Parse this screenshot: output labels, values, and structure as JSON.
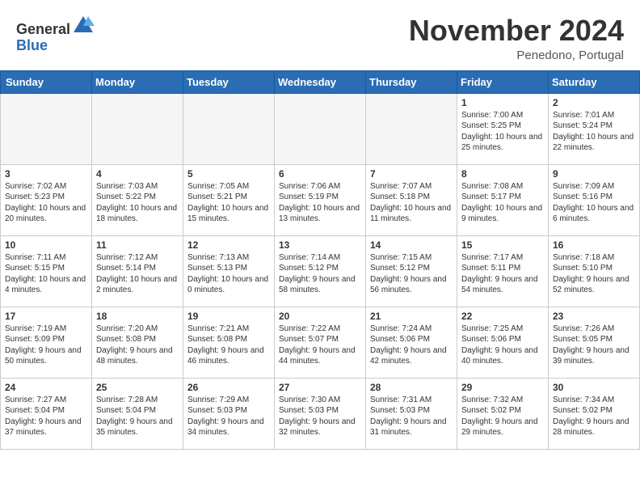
{
  "header": {
    "logo_general": "General",
    "logo_blue": "Blue",
    "month_title": "November 2024",
    "location": "Penedono, Portugal"
  },
  "days_of_week": [
    "Sunday",
    "Monday",
    "Tuesday",
    "Wednesday",
    "Thursday",
    "Friday",
    "Saturday"
  ],
  "weeks": [
    [
      {
        "day": "",
        "empty": true
      },
      {
        "day": "",
        "empty": true
      },
      {
        "day": "",
        "empty": true
      },
      {
        "day": "",
        "empty": true
      },
      {
        "day": "",
        "empty": true
      },
      {
        "day": "1",
        "sunrise": "Sunrise: 7:00 AM",
        "sunset": "Sunset: 5:25 PM",
        "daylight": "Daylight: 10 hours and 25 minutes."
      },
      {
        "day": "2",
        "sunrise": "Sunrise: 7:01 AM",
        "sunset": "Sunset: 5:24 PM",
        "daylight": "Daylight: 10 hours and 22 minutes."
      }
    ],
    [
      {
        "day": "3",
        "sunrise": "Sunrise: 7:02 AM",
        "sunset": "Sunset: 5:23 PM",
        "daylight": "Daylight: 10 hours and 20 minutes."
      },
      {
        "day": "4",
        "sunrise": "Sunrise: 7:03 AM",
        "sunset": "Sunset: 5:22 PM",
        "daylight": "Daylight: 10 hours and 18 minutes."
      },
      {
        "day": "5",
        "sunrise": "Sunrise: 7:05 AM",
        "sunset": "Sunset: 5:21 PM",
        "daylight": "Daylight: 10 hours and 15 minutes."
      },
      {
        "day": "6",
        "sunrise": "Sunrise: 7:06 AM",
        "sunset": "Sunset: 5:19 PM",
        "daylight": "Daylight: 10 hours and 13 minutes."
      },
      {
        "day": "7",
        "sunrise": "Sunrise: 7:07 AM",
        "sunset": "Sunset: 5:18 PM",
        "daylight": "Daylight: 10 hours and 11 minutes."
      },
      {
        "day": "8",
        "sunrise": "Sunrise: 7:08 AM",
        "sunset": "Sunset: 5:17 PM",
        "daylight": "Daylight: 10 hours and 9 minutes."
      },
      {
        "day": "9",
        "sunrise": "Sunrise: 7:09 AM",
        "sunset": "Sunset: 5:16 PM",
        "daylight": "Daylight: 10 hours and 6 minutes."
      }
    ],
    [
      {
        "day": "10",
        "sunrise": "Sunrise: 7:11 AM",
        "sunset": "Sunset: 5:15 PM",
        "daylight": "Daylight: 10 hours and 4 minutes."
      },
      {
        "day": "11",
        "sunrise": "Sunrise: 7:12 AM",
        "sunset": "Sunset: 5:14 PM",
        "daylight": "Daylight: 10 hours and 2 minutes."
      },
      {
        "day": "12",
        "sunrise": "Sunrise: 7:13 AM",
        "sunset": "Sunset: 5:13 PM",
        "daylight": "Daylight: 10 hours and 0 minutes."
      },
      {
        "day": "13",
        "sunrise": "Sunrise: 7:14 AM",
        "sunset": "Sunset: 5:12 PM",
        "daylight": "Daylight: 9 hours and 58 minutes."
      },
      {
        "day": "14",
        "sunrise": "Sunrise: 7:15 AM",
        "sunset": "Sunset: 5:12 PM",
        "daylight": "Daylight: 9 hours and 56 minutes."
      },
      {
        "day": "15",
        "sunrise": "Sunrise: 7:17 AM",
        "sunset": "Sunset: 5:11 PM",
        "daylight": "Daylight: 9 hours and 54 minutes."
      },
      {
        "day": "16",
        "sunrise": "Sunrise: 7:18 AM",
        "sunset": "Sunset: 5:10 PM",
        "daylight": "Daylight: 9 hours and 52 minutes."
      }
    ],
    [
      {
        "day": "17",
        "sunrise": "Sunrise: 7:19 AM",
        "sunset": "Sunset: 5:09 PM",
        "daylight": "Daylight: 9 hours and 50 minutes."
      },
      {
        "day": "18",
        "sunrise": "Sunrise: 7:20 AM",
        "sunset": "Sunset: 5:08 PM",
        "daylight": "Daylight: 9 hours and 48 minutes."
      },
      {
        "day": "19",
        "sunrise": "Sunrise: 7:21 AM",
        "sunset": "Sunset: 5:08 PM",
        "daylight": "Daylight: 9 hours and 46 minutes."
      },
      {
        "day": "20",
        "sunrise": "Sunrise: 7:22 AM",
        "sunset": "Sunset: 5:07 PM",
        "daylight": "Daylight: 9 hours and 44 minutes."
      },
      {
        "day": "21",
        "sunrise": "Sunrise: 7:24 AM",
        "sunset": "Sunset: 5:06 PM",
        "daylight": "Daylight: 9 hours and 42 minutes."
      },
      {
        "day": "22",
        "sunrise": "Sunrise: 7:25 AM",
        "sunset": "Sunset: 5:06 PM",
        "daylight": "Daylight: 9 hours and 40 minutes."
      },
      {
        "day": "23",
        "sunrise": "Sunrise: 7:26 AM",
        "sunset": "Sunset: 5:05 PM",
        "daylight": "Daylight: 9 hours and 39 minutes."
      }
    ],
    [
      {
        "day": "24",
        "sunrise": "Sunrise: 7:27 AM",
        "sunset": "Sunset: 5:04 PM",
        "daylight": "Daylight: 9 hours and 37 minutes."
      },
      {
        "day": "25",
        "sunrise": "Sunrise: 7:28 AM",
        "sunset": "Sunset: 5:04 PM",
        "daylight": "Daylight: 9 hours and 35 minutes."
      },
      {
        "day": "26",
        "sunrise": "Sunrise: 7:29 AM",
        "sunset": "Sunset: 5:03 PM",
        "daylight": "Daylight: 9 hours and 34 minutes."
      },
      {
        "day": "27",
        "sunrise": "Sunrise: 7:30 AM",
        "sunset": "Sunset: 5:03 PM",
        "daylight": "Daylight: 9 hours and 32 minutes."
      },
      {
        "day": "28",
        "sunrise": "Sunrise: 7:31 AM",
        "sunset": "Sunset: 5:03 PM",
        "daylight": "Daylight: 9 hours and 31 minutes."
      },
      {
        "day": "29",
        "sunrise": "Sunrise: 7:32 AM",
        "sunset": "Sunset: 5:02 PM",
        "daylight": "Daylight: 9 hours and 29 minutes."
      },
      {
        "day": "30",
        "sunrise": "Sunrise: 7:34 AM",
        "sunset": "Sunset: 5:02 PM",
        "daylight": "Daylight: 9 hours and 28 minutes."
      }
    ]
  ]
}
